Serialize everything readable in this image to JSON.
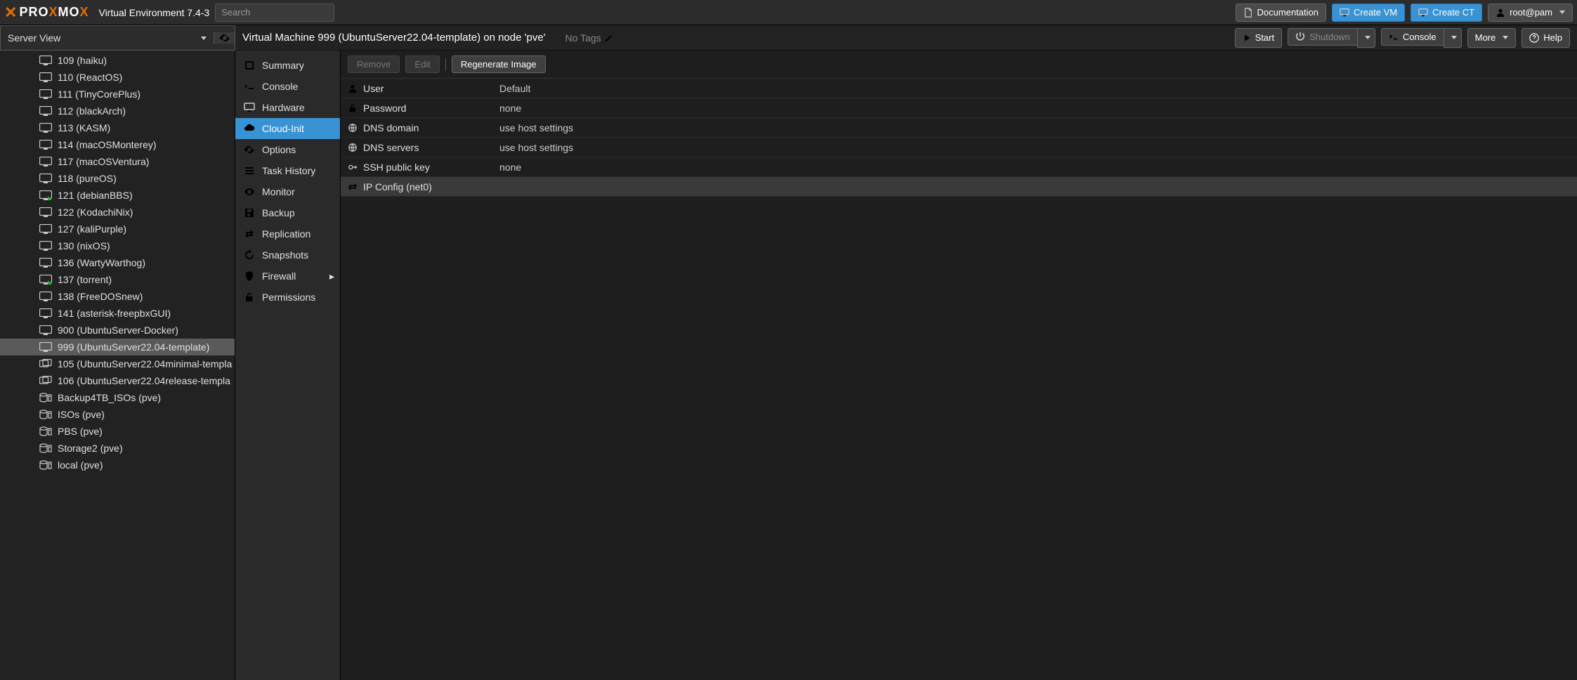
{
  "header": {
    "product_white1": "PRO",
    "product_orange": "X",
    "product_white2": "MO",
    "version": "Virtual Environment 7.4-3",
    "search_placeholder": "Search",
    "documentation": "Documentation",
    "create_vm": "Create VM",
    "create_ct": "Create CT",
    "user": "root@pam"
  },
  "subheader": {
    "server_view": "Server View",
    "breadcrumb": "Virtual Machine 999 (UbuntuServer22.04-template) on node 'pve'",
    "no_tags": "No Tags",
    "actions": {
      "start": "Start",
      "shutdown": "Shutdown",
      "console": "Console",
      "more": "More",
      "help": "Help"
    }
  },
  "tree": [
    {
      "type": "vm",
      "label": "109 (haiku)",
      "status": "off"
    },
    {
      "type": "vm",
      "label": "110 (ReactOS)",
      "status": "off"
    },
    {
      "type": "vm",
      "label": "111 (TinyCorePlus)",
      "status": "off"
    },
    {
      "type": "vm",
      "label": "112 (blackArch)",
      "status": "off"
    },
    {
      "type": "vm",
      "label": "113 (KASM)",
      "status": "off"
    },
    {
      "type": "vm",
      "label": "114 (macOSMonterey)",
      "status": "off"
    },
    {
      "type": "vm",
      "label": "117 (macOSVentura)",
      "status": "off"
    },
    {
      "type": "vm",
      "label": "118 (pureOS)",
      "status": "off"
    },
    {
      "type": "vm",
      "label": "121 (debianBBS)",
      "status": "on"
    },
    {
      "type": "vm",
      "label": "122 (KodachiNix)",
      "status": "off"
    },
    {
      "type": "vm",
      "label": "127 (kaliPurple)",
      "status": "off"
    },
    {
      "type": "vm",
      "label": "130 (nixOS)",
      "status": "off"
    },
    {
      "type": "vm",
      "label": "136 (WartyWarthog)",
      "status": "off"
    },
    {
      "type": "vm",
      "label": "137 (torrent)",
      "status": "on"
    },
    {
      "type": "vm",
      "label": "138 (FreeDOSnew)",
      "status": "off"
    },
    {
      "type": "vm",
      "label": "141 (asterisk-freepbxGUI)",
      "status": "off"
    },
    {
      "type": "vm",
      "label": "900 (UbuntuServer-Docker)",
      "status": "off"
    },
    {
      "type": "vm",
      "label": "999 (UbuntuServer22.04-template)",
      "status": "off",
      "selected": true
    },
    {
      "type": "template",
      "label": "105 (UbuntuServer22.04minimal-templa"
    },
    {
      "type": "template",
      "label": "106 (UbuntuServer22.04release-templa"
    },
    {
      "type": "storage",
      "label": "Backup4TB_ISOs (pve)"
    },
    {
      "type": "storage",
      "label": "ISOs (pve)"
    },
    {
      "type": "storage",
      "label": "PBS (pve)"
    },
    {
      "type": "storage",
      "label": "Storage2 (pve)"
    },
    {
      "type": "storage",
      "label": "local (pve)"
    }
  ],
  "midnav": [
    {
      "icon": "book",
      "label": "Summary"
    },
    {
      "icon": "terminal",
      "label": "Console"
    },
    {
      "icon": "monitor",
      "label": "Hardware"
    },
    {
      "icon": "cloud",
      "label": "Cloud-Init",
      "active": true
    },
    {
      "icon": "gear",
      "label": "Options"
    },
    {
      "icon": "list",
      "label": "Task History"
    },
    {
      "icon": "eye",
      "label": "Monitor"
    },
    {
      "icon": "save",
      "label": "Backup"
    },
    {
      "icon": "replication",
      "label": "Replication"
    },
    {
      "icon": "history",
      "label": "Snapshots"
    },
    {
      "icon": "shield",
      "label": "Firewall",
      "submenu": true
    },
    {
      "icon": "unlock",
      "label": "Permissions"
    }
  ],
  "toolbar": {
    "remove": "Remove",
    "edit": "Edit",
    "regenerate": "Regenerate Image"
  },
  "cloudinit_rows": [
    {
      "icon": "user",
      "key": "User",
      "value": "Default"
    },
    {
      "icon": "unlock",
      "key": "Password",
      "value": "none"
    },
    {
      "icon": "globe",
      "key": "DNS domain",
      "value": "use host settings"
    },
    {
      "icon": "globe",
      "key": "DNS servers",
      "value": "use host settings"
    },
    {
      "icon": "key",
      "key": "SSH public key",
      "value": "none"
    },
    {
      "icon": "exchange",
      "key": "IP Config (net0)",
      "value": "",
      "selected": true
    }
  ]
}
